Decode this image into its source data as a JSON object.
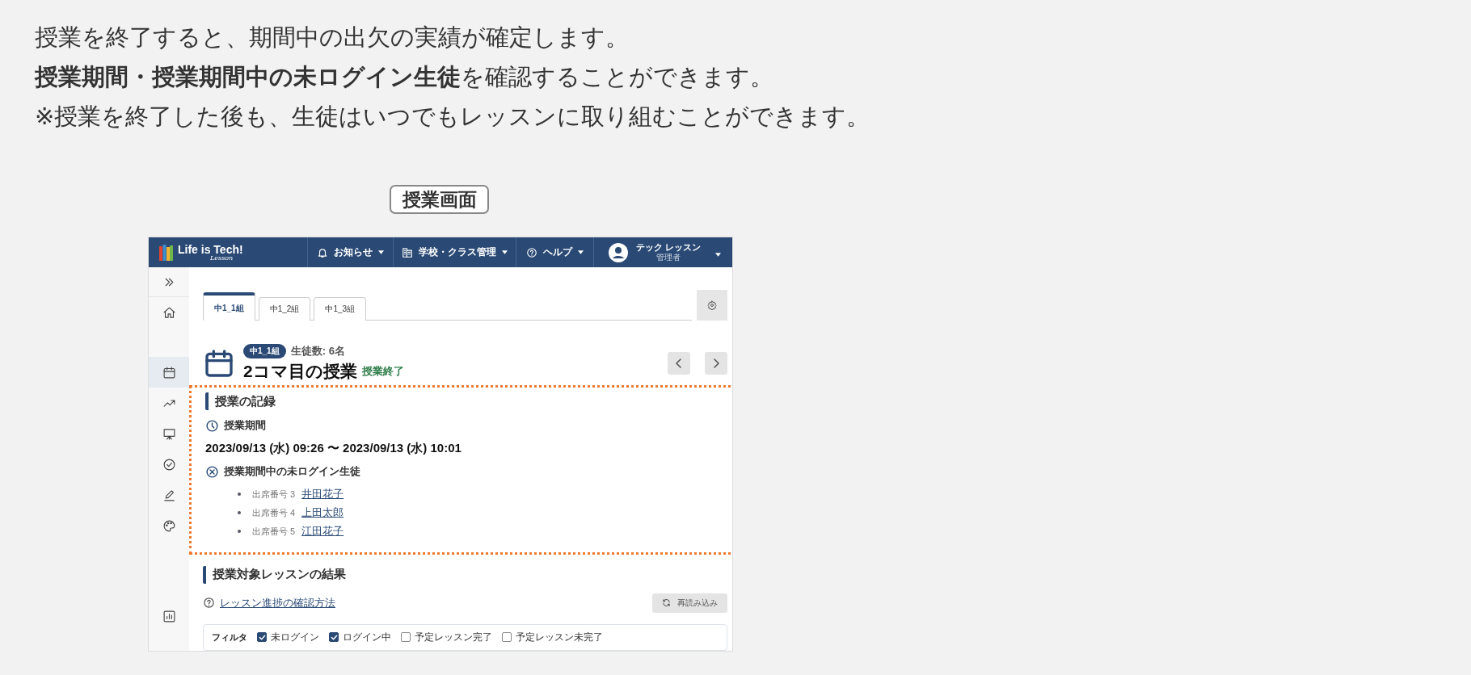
{
  "intro": {
    "lines": [
      "授業を終了すると、期間中の出欠の実績が確定します。",
      "**授業期間・授業期間中の未ログイン生徒**を確認することができます。",
      "※授業を終了した後も、生徒はいつでもレッスンに取り組むことができます。"
    ],
    "caption": "授業画面"
  },
  "header": {
    "logo": "Life is Tech!",
    "logo_sub": "Lesson",
    "nav": [
      {
        "kind": "bell",
        "label": "お知らせ"
      },
      {
        "kind": "building",
        "label": "学校・クラス管理"
      },
      {
        "kind": "help",
        "label": "ヘルプ"
      }
    ],
    "user": {
      "name": "テック レッスン",
      "role": "管理者"
    }
  },
  "sidebar": {
    "items": [
      {
        "kind": "expand",
        "selected": false
      },
      {
        "kind": "home",
        "selected": false
      },
      {
        "kind": "calendar",
        "selected": true
      },
      {
        "kind": "trend",
        "selected": false
      },
      {
        "kind": "board",
        "selected": false
      },
      {
        "kind": "check",
        "selected": false
      },
      {
        "kind": "pen",
        "selected": false
      },
      {
        "kind": "palette",
        "selected": false
      },
      {
        "kind": "chart",
        "selected": false
      }
    ]
  },
  "tabs": [
    {
      "label": "中1_1組",
      "selected": true
    },
    {
      "label": "中1_2組",
      "selected": false
    },
    {
      "label": "中1_3組",
      "selected": false
    }
  ],
  "lesson": {
    "class_badge": "中1_1組",
    "student_count": "生徒数: 6名",
    "title": "2コマ目の授業",
    "status": "授業終了"
  },
  "record": {
    "title": "授業の記録",
    "period_label": "授業期間",
    "period": "2023/09/13 (水) 09:26 〜 2023/09/13 (水) 10:01",
    "absent_label": "授業期間中の未ログイン生徒",
    "students": [
      {
        "number": "出席番号 3",
        "name": "井田花子"
      },
      {
        "number": "出席番号 4",
        "name": "上田太郎"
      },
      {
        "number": "出席番号 5",
        "name": "江田花子"
      }
    ]
  },
  "results": {
    "title": "授業対象レッスンの結果",
    "help_link": "レッスン進捗の確認方法",
    "reload": "再読み込み",
    "filter_label": "フィルタ",
    "filters": [
      {
        "label": "未ログイン",
        "checked": true
      },
      {
        "label": "ログイン中",
        "checked": true
      },
      {
        "label": "予定レッスン完了",
        "checked": false
      },
      {
        "label": "予定レッスン未完了",
        "checked": false
      }
    ]
  }
}
